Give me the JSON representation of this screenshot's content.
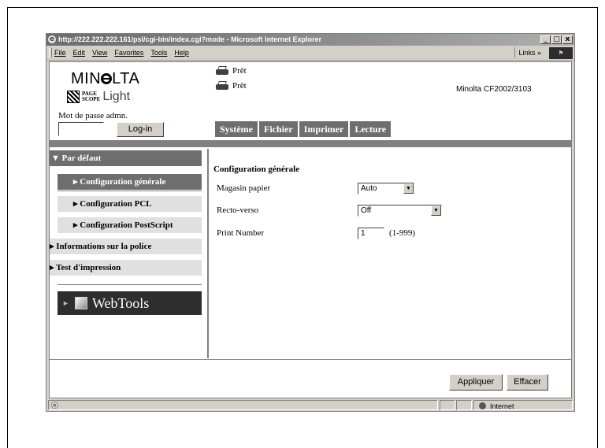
{
  "browser": {
    "title": "http://222.222.222.161/psl/cgi-bin/index.cgi?mode - Microsoft Internet Explorer",
    "window_buttons": [
      "_",
      "©",
      "x"
    ],
    "menu": [
      "File",
      "Edit",
      "View",
      "Favorites",
      "Tools",
      "Help"
    ],
    "links_label": "Links »",
    "status_zone": "Internet"
  },
  "header": {
    "brand": {
      "pre": "MIN",
      "post": "LTA"
    },
    "pagescope": {
      "line1": "PAGE",
      "line2": "SCOPE",
      "light": "Light"
    },
    "password_label": "Mot de passe admn.",
    "login_button": "Log-in",
    "printer_status": [
      "Prêt",
      "Prêt"
    ],
    "model": "Minolta CF2002/3103"
  },
  "tabs": [
    "Système",
    "Fichier",
    "Imprimer",
    "Lecture"
  ],
  "sidebar": {
    "items": [
      {
        "label": "▼ Par défaut"
      },
      {
        "label": "▸ Configuration générale"
      },
      {
        "label": "▸ Configuration PCL"
      },
      {
        "label": "▸ Configuration PostScript"
      },
      {
        "label": "▸ Informations sur la police"
      },
      {
        "label": "▸ Test d'impression"
      }
    ],
    "webtools": "WebTools"
  },
  "form": {
    "title": "Configuration générale",
    "fields": [
      {
        "label": "Magasin papier",
        "value": "Auto"
      },
      {
        "label": "Recto-verso",
        "value": "Off"
      },
      {
        "label": "Print Number",
        "value": "1",
        "range": "(1-999)"
      }
    ],
    "apply_button": "Appliquer",
    "clear_button": "Effacer"
  }
}
